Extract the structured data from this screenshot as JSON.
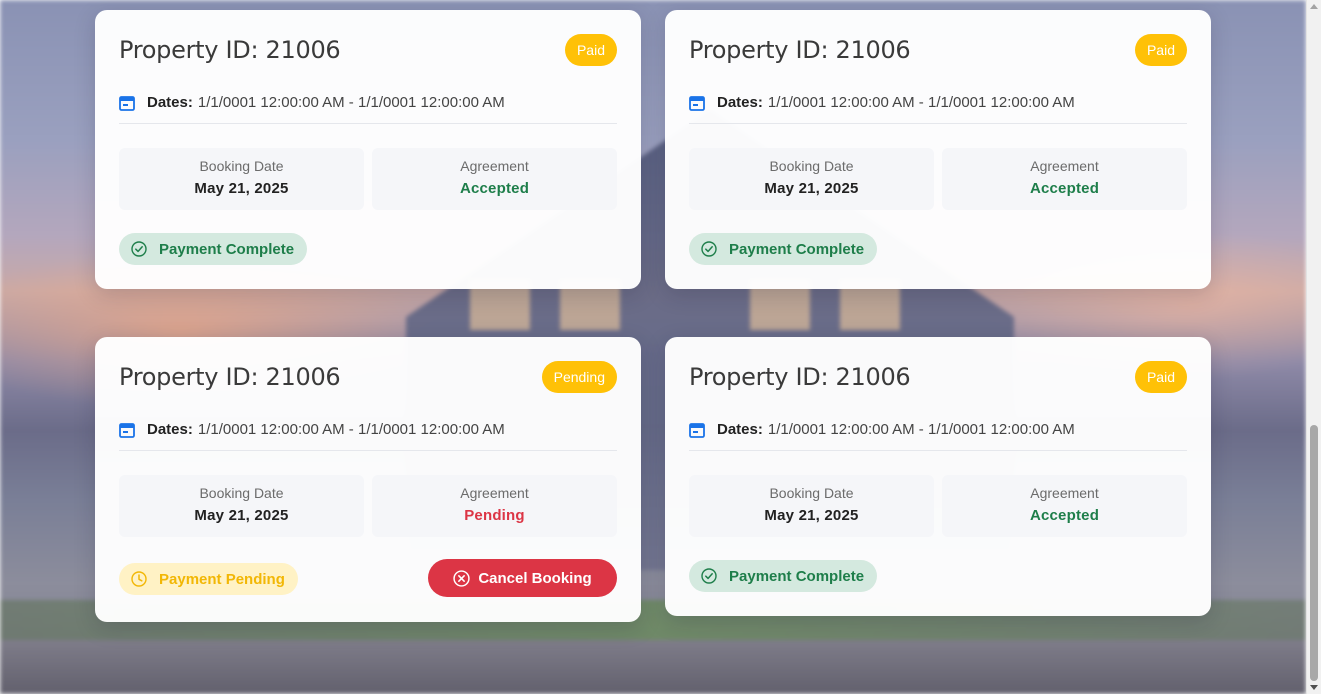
{
  "colors": {
    "badge_yellow": "#ffc107",
    "success_green": "#1e7e4a",
    "danger_red": "#dc3545",
    "pending_amber": "#f2b705",
    "icon_blue": "#1a73e8"
  },
  "icons": {
    "dates": "calendar-icon",
    "payment_complete": "check-circle-icon",
    "payment_pending": "clock-icon",
    "cancel": "x-circle-icon"
  },
  "bookings": [
    {
      "title": "Property ID: 21006",
      "status": "Paid",
      "dates_label": "Dates:",
      "dates_value": "1/1/0001 12:00:00 AM - 1/1/0001 12:00:00 AM",
      "booking_date_label": "Booking Date",
      "booking_date": "May 21, 2025",
      "agreement_label": "Agreement",
      "agreement": "Accepted",
      "payment": "Payment Complete"
    },
    {
      "title": "Property ID: 21006",
      "status": "Paid",
      "dates_label": "Dates:",
      "dates_value": "1/1/0001 12:00:00 AM - 1/1/0001 12:00:00 AM",
      "booking_date_label": "Booking Date",
      "booking_date": "May 21, 2025",
      "agreement_label": "Agreement",
      "agreement": "Accepted",
      "payment": "Payment Complete"
    },
    {
      "title": "Property ID: 21006",
      "status": "Pending",
      "dates_label": "Dates:",
      "dates_value": "1/1/0001 12:00:00 AM - 1/1/0001 12:00:00 AM",
      "booking_date_label": "Booking Date",
      "booking_date": "May 21, 2025",
      "agreement_label": "Agreement",
      "agreement": "Pending",
      "payment": "Payment Pending",
      "cancel_label": "Cancel Booking"
    },
    {
      "title": "Property ID: 21006",
      "status": "Paid",
      "dates_label": "Dates:",
      "dates_value": "1/1/0001 12:00:00 AM - 1/1/0001 12:00:00 AM",
      "booking_date_label": "Booking Date",
      "booking_date": "May 21, 2025",
      "agreement_label": "Agreement",
      "agreement": "Accepted",
      "payment": "Payment Complete"
    }
  ]
}
